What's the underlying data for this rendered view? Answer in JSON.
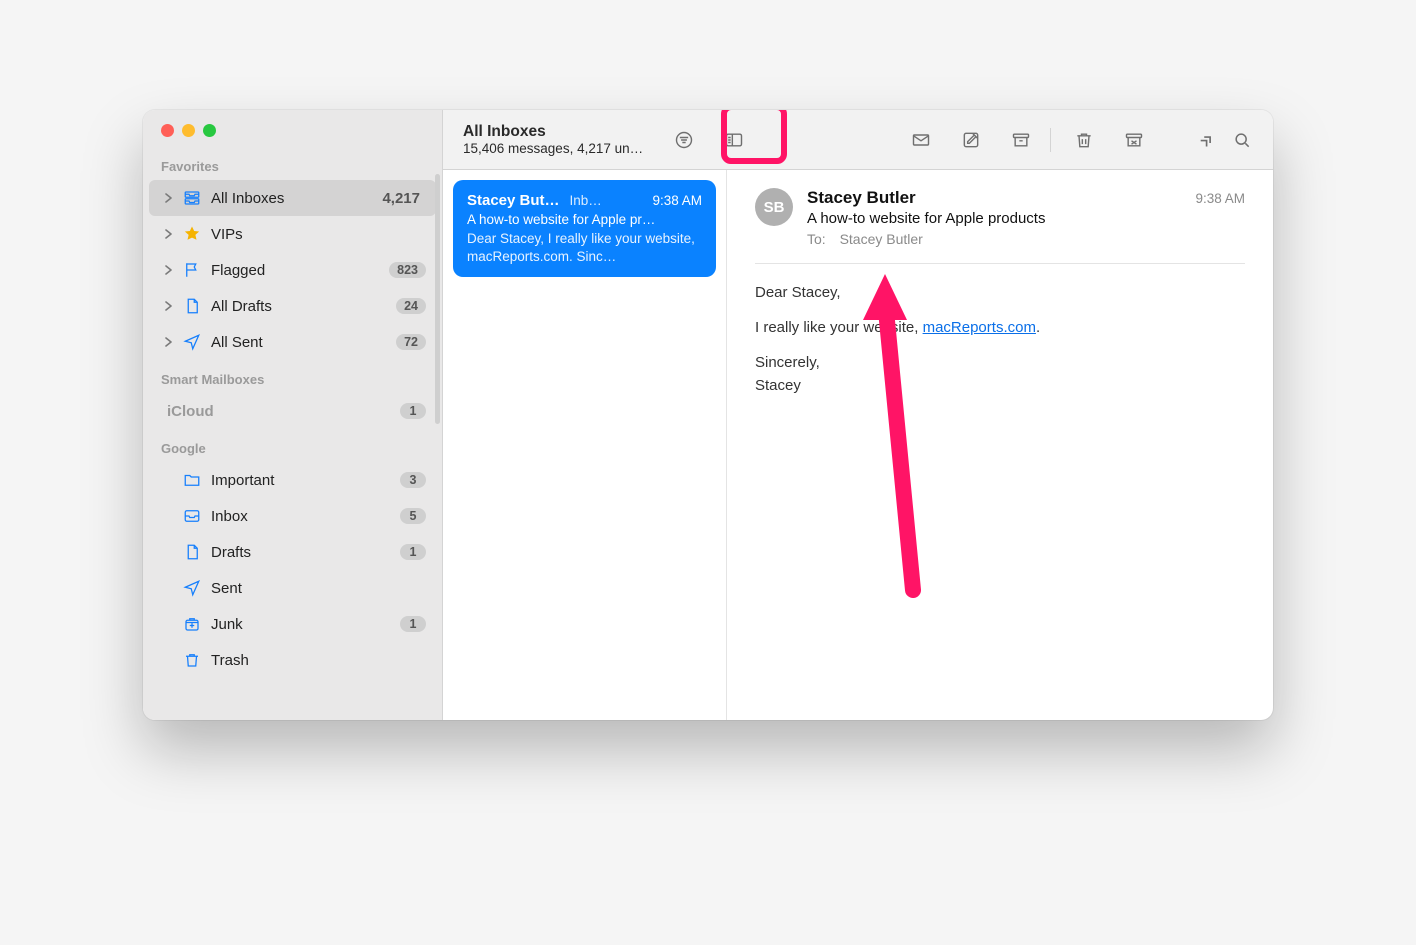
{
  "sidebar": {
    "sections": {
      "favorites_label": "Favorites",
      "smart_label": "Smart Mailboxes",
      "icloud_label": "iCloud",
      "icloud_badge": "1",
      "google_label": "Google"
    },
    "favorites": [
      {
        "id": "all-inboxes",
        "label": "All Inboxes",
        "count": "4,217",
        "icon": "inbox"
      },
      {
        "id": "vips",
        "label": "VIPs",
        "count": "",
        "icon": "star"
      },
      {
        "id": "flagged",
        "label": "Flagged",
        "count": "823",
        "icon": "flag",
        "badge": true
      },
      {
        "id": "drafts",
        "label": "All Drafts",
        "count": "24",
        "icon": "file",
        "badge": true
      },
      {
        "id": "sent",
        "label": "All Sent",
        "count": "72",
        "icon": "send",
        "badge": true
      }
    ],
    "google": [
      {
        "id": "important",
        "label": "Important",
        "count": "3",
        "icon": "folder"
      },
      {
        "id": "inbox",
        "label": "Inbox",
        "count": "5",
        "icon": "inbox"
      },
      {
        "id": "gdrafts",
        "label": "Drafts",
        "count": "1",
        "icon": "file"
      },
      {
        "id": "gsent",
        "label": "Sent",
        "count": "",
        "icon": "send"
      },
      {
        "id": "junk",
        "label": "Junk",
        "count": "1",
        "icon": "junk"
      },
      {
        "id": "trash",
        "label": "Trash",
        "count": "",
        "icon": "trash"
      }
    ]
  },
  "header": {
    "title": "All Inboxes",
    "subtitle": "15,406 messages, 4,217 un…"
  },
  "toolbar_icons": {
    "filter": "filter-circle-icon",
    "layout": "layout-icon",
    "envelope": "envelope-icon",
    "compose": "compose-icon",
    "archive": "archive-icon",
    "delete": "trash-icon",
    "spam": "spam-icon",
    "more": "chevrons-icon",
    "search": "search-icon"
  },
  "message_list": [
    {
      "sender": "Stacey But…",
      "mailbox": "Inb…",
      "time": "9:38 AM",
      "subject": "A how-to website for Apple pr…",
      "preview": "Dear Stacey, I really like your website, macReports.com. Sinc…"
    }
  ],
  "reader": {
    "avatar": "SB",
    "sender": "Stacey Butler",
    "time": "9:38 AM",
    "subject": "A how-to website for Apple products",
    "to_label": "To:",
    "to_value": "Stacey Butler",
    "body": {
      "greeting": "Dear Stacey,",
      "p1_pre": "I really like your website, ",
      "p1_link": "macReports.com",
      "p1_post": ".",
      "signoff": "Sincerely,",
      "signature": "Stacey"
    }
  }
}
